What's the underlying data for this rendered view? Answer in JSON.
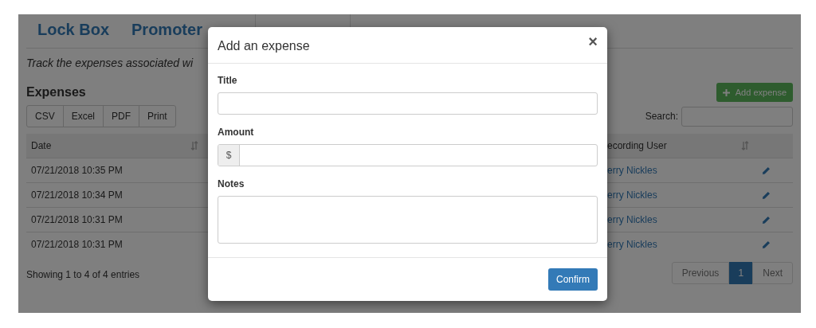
{
  "page": {
    "tabs": [
      {
        "label": "Lock Box"
      },
      {
        "label": "Promoter"
      }
    ],
    "description": "Track the expenses associated wi",
    "heading": "Expenses",
    "add_button": "Add expense",
    "export_buttons": [
      "CSV",
      "Excel",
      "PDF",
      "Print"
    ],
    "search": {
      "label": "Search:"
    },
    "table": {
      "columns": [
        {
          "label": "Date"
        },
        {
          "label": "ecording User"
        }
      ],
      "rows": [
        {
          "date": "07/21/2018 10:35 PM",
          "user": "erry Nickles"
        },
        {
          "date": "07/21/2018 10:34 PM",
          "user": "erry Nickles"
        },
        {
          "date": "07/21/2018 10:31 PM",
          "user": "erry Nickles"
        },
        {
          "date": "07/21/2018 10:31 PM",
          "user": "erry Nickles"
        }
      ]
    },
    "info": "Showing 1 to 4 of 4 entries",
    "pagination": {
      "previous": {
        "label": "Previous",
        "disabled": true
      },
      "pages": [
        {
          "label": "1",
          "selected": true
        }
      ],
      "next": {
        "label": "Next",
        "disabled": true
      }
    }
  },
  "modal": {
    "title": "Add an expense",
    "close": "×",
    "fields": [
      {
        "kind": "text",
        "label": "Title"
      },
      {
        "kind": "money",
        "label": "Amount",
        "prefix": "$"
      },
      {
        "kind": "textarea",
        "label": "Notes"
      }
    ],
    "confirm": "Confirm"
  }
}
